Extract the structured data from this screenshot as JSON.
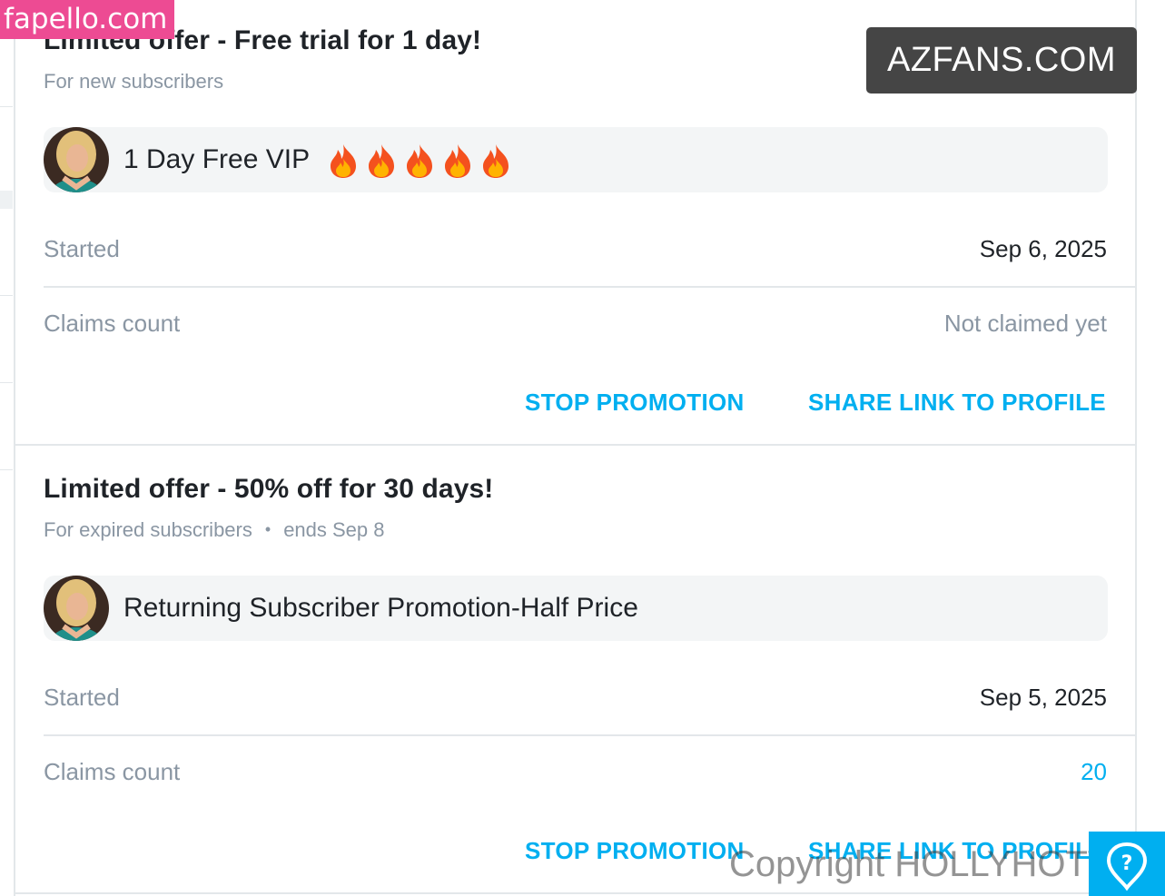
{
  "promotions": [
    {
      "title": "Limited offer - Free trial for 1 day!",
      "audience": "For new subscribers",
      "ends": "",
      "message": "1 Day Free VIP",
      "emoji": [
        "fire-icon",
        "fire-icon",
        "fire-icon",
        "fire-icon",
        "fire-icon"
      ],
      "started_label": "Started",
      "started_value": "Sep 6, 2025",
      "claims_label": "Claims count",
      "claims_value": "Not claimed yet",
      "stop_label": "STOP PROMOTION",
      "share_label": "SHARE LINK TO PROFILE"
    },
    {
      "title": "Limited offer - 50% off for 30 days!",
      "audience": "For expired subscribers",
      "ends": "ends Sep 8",
      "message": "Returning Subscriber Promotion-Half Price",
      "started_label": "Started",
      "started_value": "Sep 5, 2025",
      "claims_label": "Claims count",
      "claims_value": "20",
      "stop_label": "STOP PROMOTION",
      "share_label": "SHARE LINK TO PROFILE"
    }
  ],
  "watermarks": {
    "top_left": "fapello.com",
    "top_right": "AZFANS.COM",
    "bottom_right": "Copyright HOLLYHOTWIFE"
  },
  "colors": {
    "accent": "#00aff0",
    "muted_text": "#8a96a3",
    "primary_text": "#1f2328",
    "divider": "#e3e7ea",
    "promo_bar": "#f3f5f6",
    "fapello_pink": "#ed4b93",
    "azfans_gray": "#454545"
  }
}
